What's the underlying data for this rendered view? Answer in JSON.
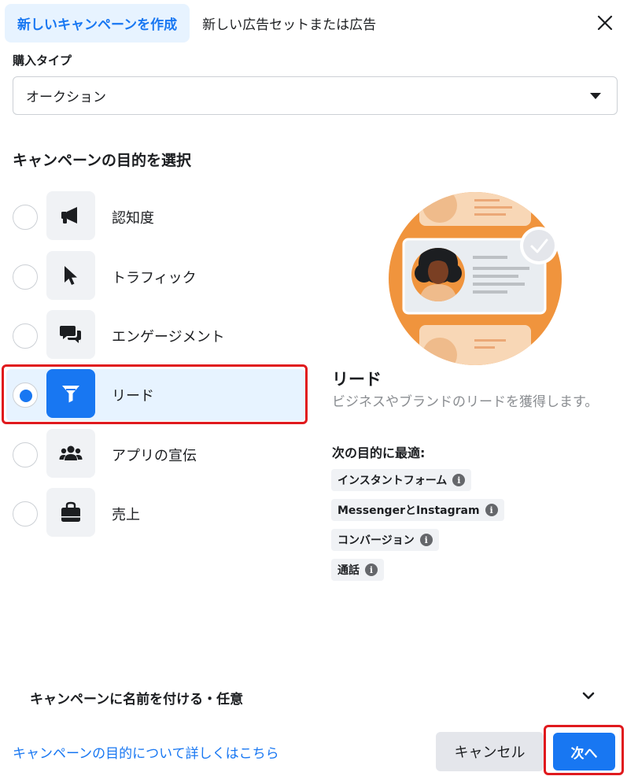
{
  "tabs": {
    "active": "新しいキャンペーンを作成",
    "inactive": "新しい広告セットまたは広告"
  },
  "buy_type": {
    "label": "購入タイプ",
    "value": "オークション"
  },
  "objectives": {
    "title": "キャンペーンの目的を選択",
    "items": [
      {
        "label": "認知度",
        "icon": "megaphone-icon",
        "selected": false
      },
      {
        "label": "トラフィック",
        "icon": "cursor-icon",
        "selected": false
      },
      {
        "label": "エンゲージメント",
        "icon": "chat-bubbles-icon",
        "selected": false
      },
      {
        "label": "リード",
        "icon": "funnel-icon",
        "selected": true
      },
      {
        "label": "アプリの宣伝",
        "icon": "people-icon",
        "selected": false
      },
      {
        "label": "売上",
        "icon": "shopping-bag-icon",
        "selected": false
      }
    ]
  },
  "detail": {
    "title": "リード",
    "description": "ビジネスやブランドのリードを獲得します。",
    "best_for_label": "次の目的に最適:",
    "chips": [
      "インスタントフォーム",
      "MessengerとInstagram",
      "コンバージョン",
      "通話"
    ],
    "info_glyph": "i"
  },
  "campaign_name": {
    "label": "キャンペーンに名前を付ける・任意"
  },
  "footer": {
    "learn_more": "キャンペーンの目的について詳しくはこちら",
    "cancel": "キャンセル",
    "next": "次へ"
  },
  "colors": {
    "accent": "#1877f2",
    "highlight": "#e0191d",
    "illustration_orange": "#f0943d"
  }
}
